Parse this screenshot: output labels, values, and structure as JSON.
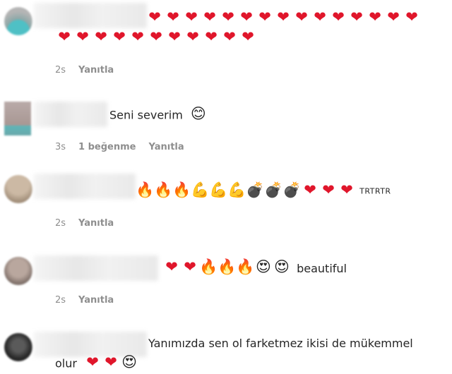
{
  "comments": [
    {
      "text": "",
      "emojis_line1": [
        "heart",
        "heart",
        "heart",
        "heart",
        "heart",
        "heart",
        "heart",
        "heart",
        "heart",
        "heart",
        "heart",
        "heart",
        "heart",
        "heart",
        "heart"
      ],
      "emojis_line2": [
        "heart",
        "heart",
        "heart",
        "heart",
        "heart",
        "heart",
        "heart",
        "heart",
        "heart",
        "heart",
        "heart"
      ],
      "time": "2s",
      "reply_label": "Yanıtla"
    },
    {
      "text": "Seni severim",
      "emojis": [
        "smile"
      ],
      "time": "3s",
      "likes_label": "1 beğenme",
      "reply_label": "Yanıtla"
    },
    {
      "emojis": [
        "fire",
        "fire",
        "fire",
        "muscle",
        "muscle",
        "muscle",
        "bomb",
        "bomb",
        "bomb",
        "heart",
        "heart",
        "heart"
      ],
      "suffix": "TRTRTR",
      "time": "2s",
      "reply_label": "Yanıtla"
    },
    {
      "emojis": [
        "heart",
        "heart",
        "fire",
        "fire",
        "fire",
        "heart-eyes",
        "heart-eyes"
      ],
      "suffix": "beautiful",
      "time": "2s",
      "reply_label": "Yanıtla"
    },
    {
      "text_line1": "Yanımızda sen ol farketmez ikisi de mükemmel",
      "text_line2": "olur",
      "emojis": [
        "heart",
        "heart",
        "heart-eyes"
      ]
    }
  ],
  "glyphs": {
    "heart": "❤",
    "fire": "🔥",
    "muscle": "💪",
    "bomb": "💣",
    "smile": "😊",
    "heart-eyes": "😍"
  },
  "colors": {
    "heart": "#e0162b",
    "meta_text": "#8e8e8e",
    "body_text": "#262626"
  }
}
